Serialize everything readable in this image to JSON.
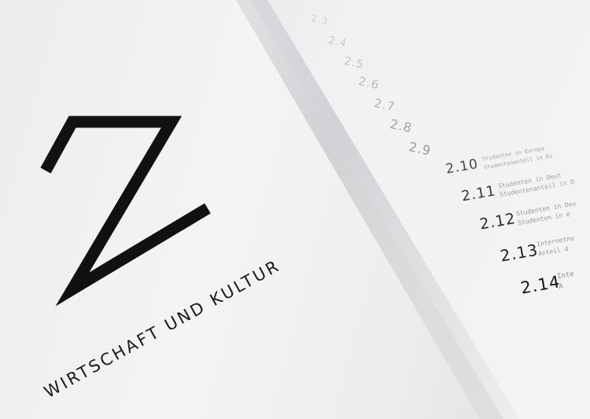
{
  "left_page": {
    "chapter_letter": "Z",
    "chapter_title": "WIRTSCHAFT UND KULTUR"
  },
  "toc": {
    "entries": [
      {
        "number": "2.3",
        "lines": []
      },
      {
        "number": "2.4",
        "lines": []
      },
      {
        "number": "2.5",
        "lines": []
      },
      {
        "number": "2.6",
        "lines": []
      },
      {
        "number": "2.7",
        "lines": []
      },
      {
        "number": "2.8",
        "lines": []
      },
      {
        "number": "2.9",
        "lines": []
      },
      {
        "number": "2.10",
        "lines": [
          "Studenten in Europa",
          "Studentenanteil in Eu"
        ]
      },
      {
        "number": "2.11",
        "lines": [
          "Studenten in Deut",
          "Studentenanteil in D"
        ]
      },
      {
        "number": "2.12",
        "lines": [
          "Studenten in Deu",
          "Studenten in e"
        ]
      },
      {
        "number": "2.13",
        "lines": [
          "Internetnu",
          "Anteil d"
        ]
      },
      {
        "number": "2.14",
        "lines": [
          "Inte",
          "A"
        ]
      }
    ]
  },
  "colors": {
    "ink": "#111111",
    "toc_text": "#8d9094",
    "page": "#f2f2f3"
  }
}
